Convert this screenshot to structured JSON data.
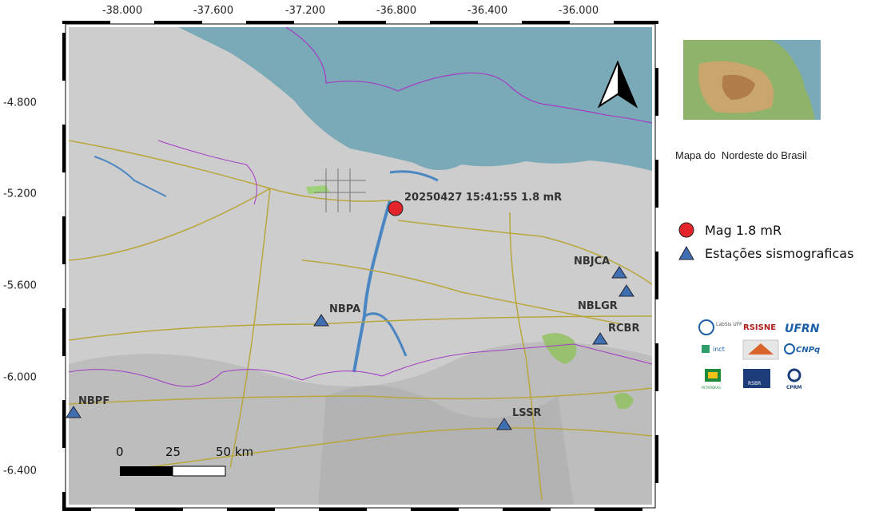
{
  "map": {
    "lon_ticks": [
      "-38.000",
      "-37.600",
      "-37.200",
      "-36.800",
      "-36.400",
      "-36.000"
    ],
    "lat_ticks": [
      "-4.800",
      "-5.200",
      "-5.600",
      "-6.000",
      "-6.400"
    ],
    "event_label": "20250427 15:41:55 1.8 mR",
    "stations": [
      {
        "code": "NBJCA"
      },
      {
        "code": "NBLGR"
      },
      {
        "code": "RCBR"
      },
      {
        "code": "NBPA"
      },
      {
        "code": "NBPF"
      },
      {
        "code": "LSSR"
      }
    ],
    "scale_bar": {
      "label_0": "0",
      "label_25": "25",
      "label_50": "50 km"
    },
    "north_arrow": "north-arrow"
  },
  "inset": {
    "caption": "Mapa do  Nordeste do Brasil"
  },
  "legend": {
    "event": {
      "label": "Mag 1.8 mR",
      "color": "#e3242b"
    },
    "stations": {
      "label": "Estações sismograficas",
      "color": "#3f6fb0"
    }
  },
  "logos": {
    "labsis": "LabSis UFRN",
    "rsisne": "RSISNE",
    "ufrn": "UFRN",
    "inct": "inct",
    "cnpq": "CNPq",
    "petrobras": "PETROBRAS",
    "rsbr": "RSBR",
    "cprm": "CPRM"
  },
  "colors": {
    "sea": "#7aa9b8",
    "land": "#cfcfcf",
    "roads": "#b9a63c",
    "rivers": "#4a86c2",
    "borders": "#a43cc4"
  }
}
